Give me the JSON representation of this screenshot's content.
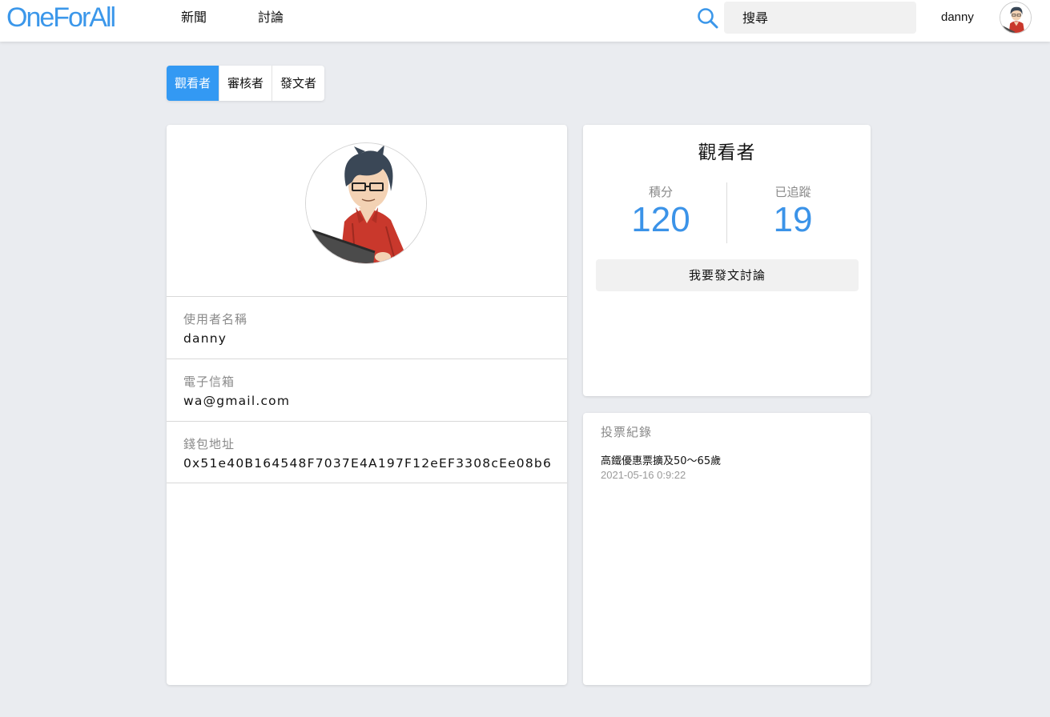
{
  "header": {
    "logo": "OneForAll",
    "nav": {
      "news": "新聞",
      "discussion": "討論"
    },
    "search_placeholder": "搜尋",
    "username": "danny",
    "brand_color": "#3b97ea"
  },
  "role_tabs": {
    "items": [
      "觀看者",
      "審核者",
      "發文者"
    ],
    "active": "觀看者",
    "active_color": "#3399f3"
  },
  "profile": {
    "fields": [
      {
        "label": "使用者名稱",
        "value": "danny"
      },
      {
        "label": "電子信箱",
        "value": "wa@gmail.com"
      },
      {
        "label": "錢包地址",
        "value": "0x51e40B164548F7037E4A197F12eEF3308cEe08b6"
      }
    ]
  },
  "stats": {
    "title": "觀看者",
    "points_label": "積分",
    "points_value": "120",
    "following_label": "已追蹤",
    "following_value": "19",
    "post_button": "我要發文討論",
    "value_color": "#3b93e8"
  },
  "votes": {
    "title": "投票紀錄",
    "items": [
      {
        "name": "高鐵優惠票擴及50～65歲",
        "time": "2021-05-16 0:9:22"
      }
    ]
  },
  "icons": {
    "search": "search-icon",
    "avatar": "avatar"
  }
}
